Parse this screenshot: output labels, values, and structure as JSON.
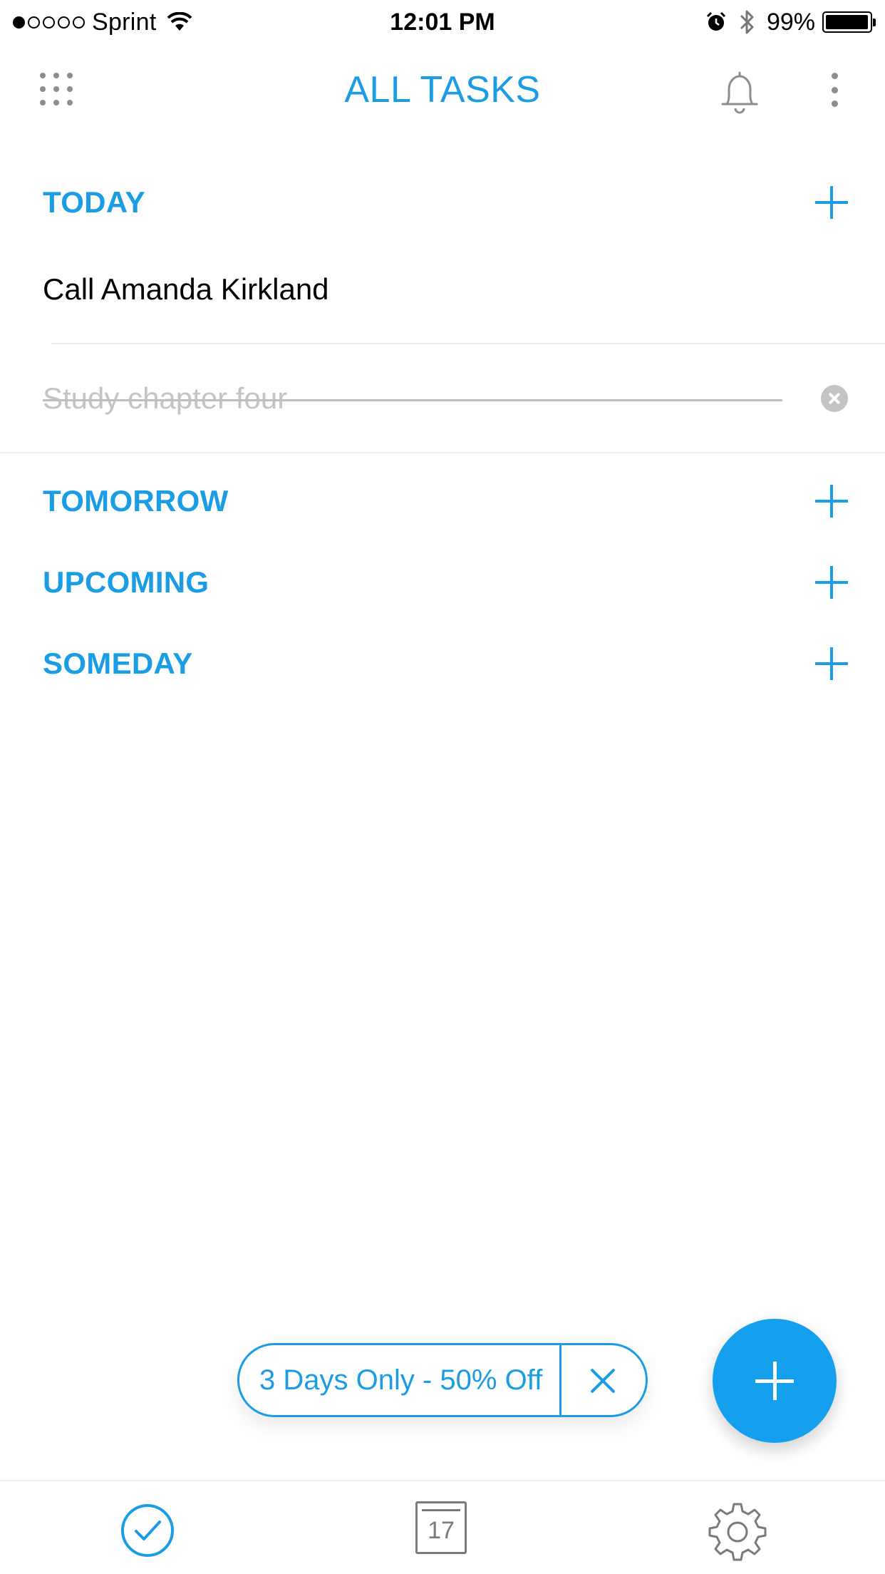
{
  "status_bar": {
    "carrier": "Sprint",
    "time": "12:01 PM",
    "battery_percent": "99%",
    "battery_level": 0.99,
    "signal_strength": 1
  },
  "header": {
    "title": "ALL TASKS",
    "left_icon": "grid-menu-icon",
    "right_icons": [
      "bell-icon",
      "more-vertical-icon"
    ]
  },
  "sections": {
    "today": {
      "title": "TODAY"
    },
    "tomorrow": {
      "title": "TOMORROW"
    },
    "upcoming": {
      "title": "UPCOMING"
    },
    "someday": {
      "title": "SOMEDAY"
    }
  },
  "tasks": [
    {
      "text": "Call Amanda Kirkland",
      "completed": false
    },
    {
      "text": "Study chapter four",
      "completed": true
    }
  ],
  "promo": {
    "text": "3 Days Only - 50% Off"
  },
  "tab_bar": {
    "calendar_day": "17",
    "tabs": [
      "check-circle-icon",
      "calendar-icon",
      "gear-icon"
    ]
  },
  "colors": {
    "accent": "#1a9de5",
    "fab": "#14a0ec",
    "muted_text": "#c4c4c4",
    "icon_gray": "#8d8d8d"
  }
}
